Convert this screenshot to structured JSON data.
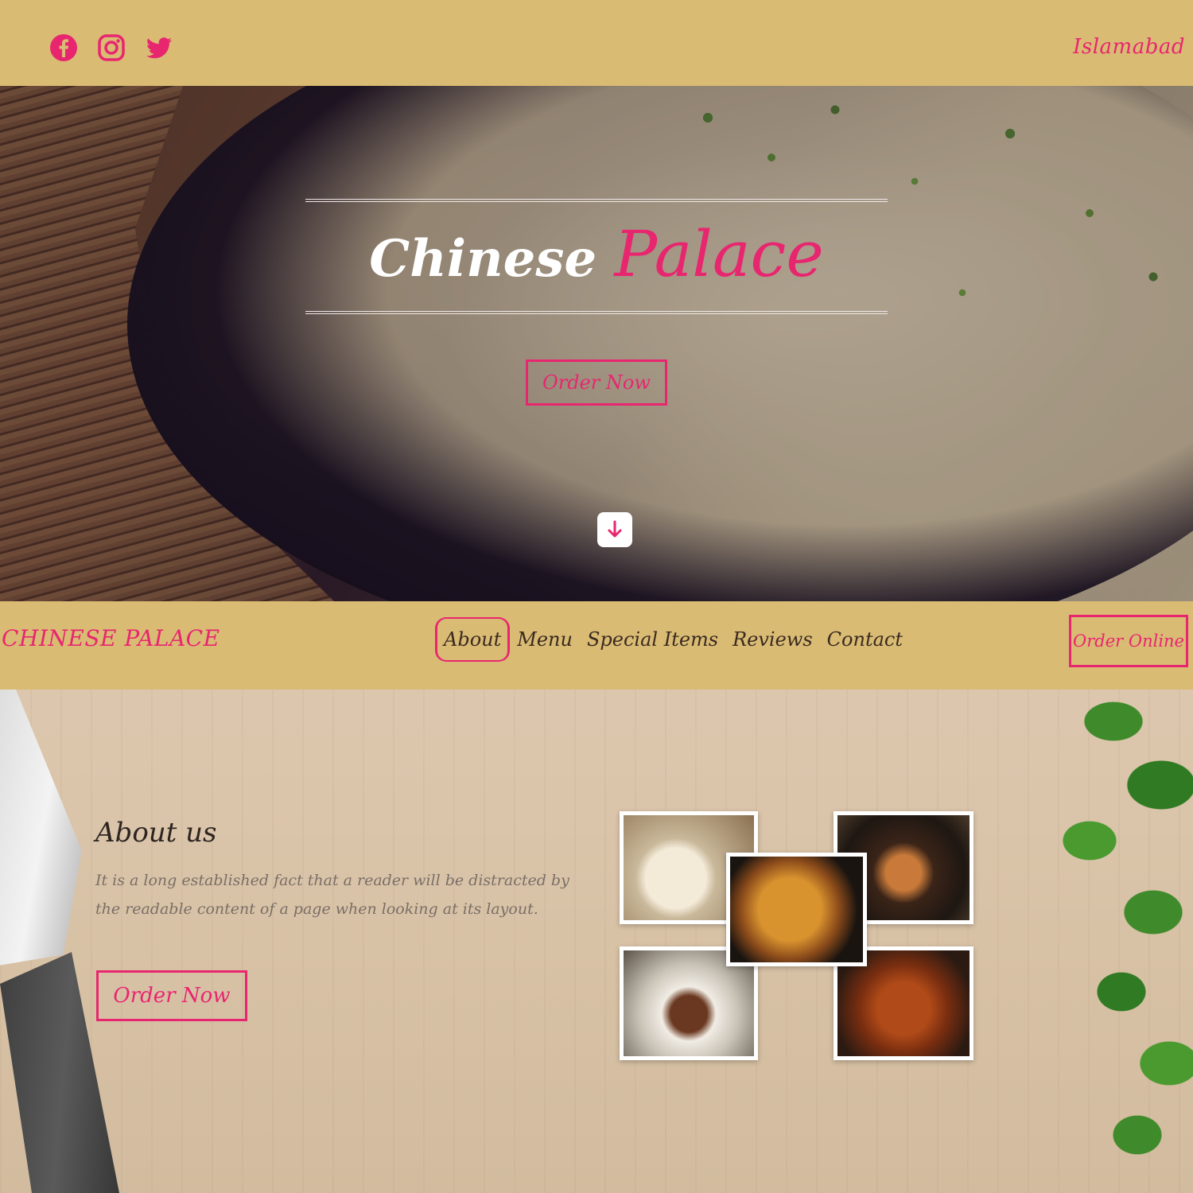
{
  "topbar": {
    "social_icons": [
      "facebook-icon",
      "instagram-icon",
      "twitter-icon"
    ],
    "location": "Islamabad"
  },
  "hero": {
    "title_part1": "Chinese",
    "title_part2": "Palace",
    "cta_label": "Order Now",
    "scroll_icon": "arrow-down-icon"
  },
  "nav": {
    "brand": "CHINESE PALACE",
    "items": [
      "About",
      "Menu",
      "Special Items",
      "Reviews",
      "Contact"
    ],
    "active_item": "About",
    "cta_label": "Order Online"
  },
  "about": {
    "title": "About us",
    "text": "It is a long established fact that a reader will be distracted by the readable content of a page when looking at its layout.",
    "cta_label": "Order Now",
    "photos": [
      "dumplings",
      "stir-fry-bowl",
      "noodles",
      "steak-plate",
      "fried-chicken"
    ]
  },
  "colors": {
    "accent": "#e8266f",
    "bar_background": "#d9bb74",
    "text_dark": "#3a2a20"
  }
}
